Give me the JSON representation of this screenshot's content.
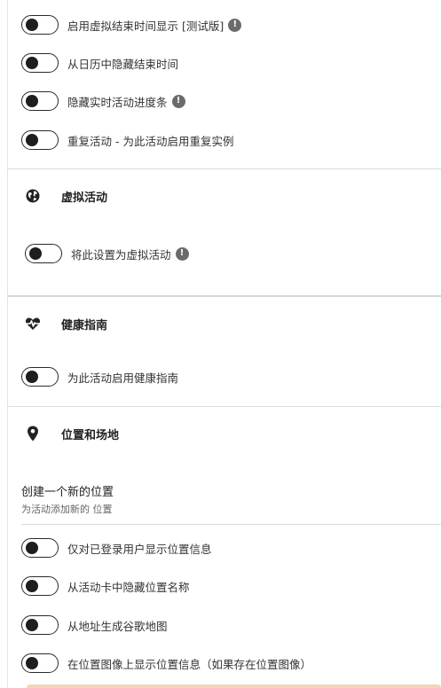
{
  "event_options": {
    "toggles": [
      {
        "label": "启用虚拟结束时间显示 [测试版]",
        "on": false,
        "info": true
      },
      {
        "label": "从日历中隐藏结束时间",
        "on": false,
        "info": false
      },
      {
        "label": "隐藏实时活动进度条",
        "on": false,
        "info": true
      },
      {
        "label": "重复活动 - 为此活动启用重复实例",
        "on": false,
        "info": false
      }
    ]
  },
  "virtual_event": {
    "title": "虚拟活动",
    "icon": "globe-icon",
    "toggle": {
      "label": "将此设置为虚拟活动",
      "on": false,
      "info": true
    }
  },
  "health_guide": {
    "title": "健康指南",
    "icon": "heartbeat-icon",
    "toggle": {
      "label": "为此活动启用健康指南",
      "on": false
    }
  },
  "location": {
    "title": "位置和场地",
    "icon": "map-pin-icon",
    "create_title": "创建一个新的位置",
    "create_subtitle": "为活动添加新的 位置",
    "toggles": [
      {
        "label": "仅对已登录用户显示位置信息",
        "on": false
      },
      {
        "label": "从活动卡中隐藏位置名称",
        "on": false
      },
      {
        "label": "从地址生成谷歌地图",
        "on": false
      },
      {
        "label": "在位置图像上显示位置信息（如果存在位置图像）",
        "on": false
      }
    ]
  },
  "colors": {
    "toggle_border": "#2a2a2a",
    "toggle_knob": "#1e1e1e",
    "info_icon": "#6b6b6b",
    "divider": "#dddddd",
    "bottom_accent": "#f2d6b8"
  }
}
